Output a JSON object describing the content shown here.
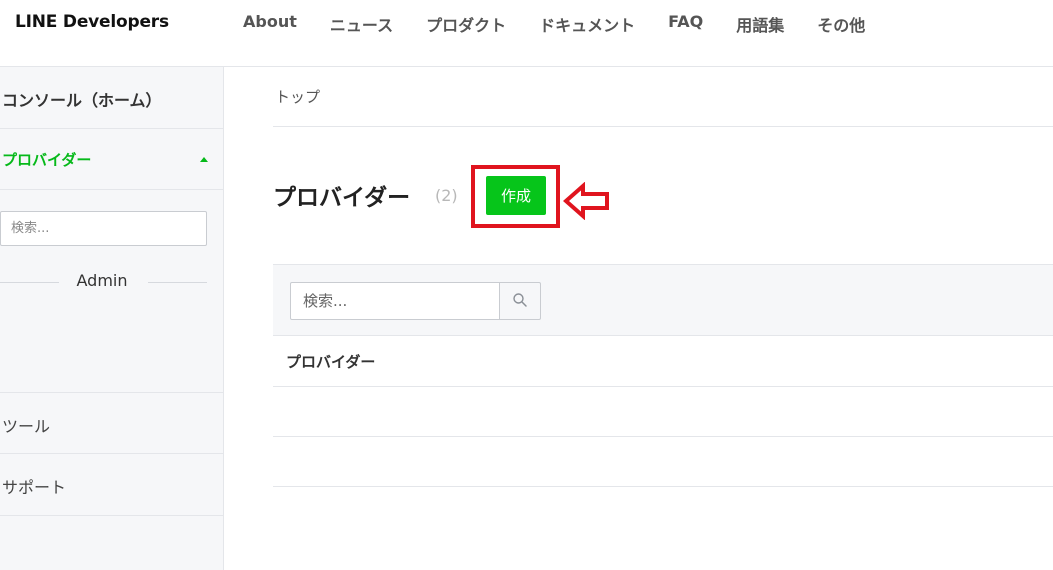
{
  "header": {
    "logo": "LINE Developers",
    "nav": [
      "About",
      "ニュース",
      "プロダクト",
      "ドキュメント",
      "FAQ",
      "用語集",
      "その他"
    ]
  },
  "sidebar": {
    "console_label": "コンソール（ホーム）",
    "provider_label": "プロバイダー",
    "search_placeholder": "検索...",
    "admin_label": "Admin",
    "tools_label": "ツール",
    "support_label": "サポート"
  },
  "main": {
    "breadcrumb": "トップ",
    "title": "プロバイダー",
    "count": "(2)",
    "create_button": "作成",
    "search_placeholder": "検索...",
    "table_header": "プロバイダー",
    "rows": [
      "",
      ""
    ]
  },
  "colors": {
    "accent_green": "#06c51a",
    "highlight_red": "#e0141e"
  }
}
